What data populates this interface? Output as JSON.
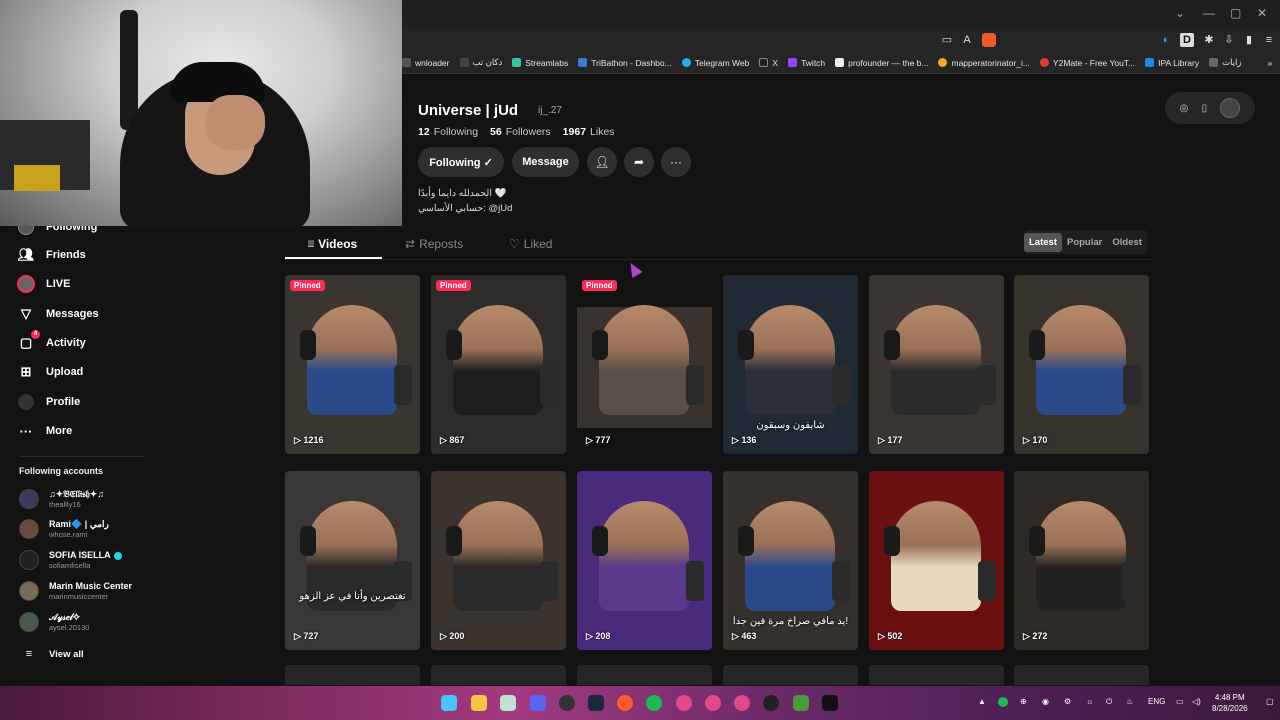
{
  "browser": {
    "bookmarks": [
      {
        "label": "wnloader",
        "color": "#555"
      },
      {
        "label": "دكان تب",
        "color": "#444"
      },
      {
        "label": "Streamlabs",
        "color": "#31c3a2"
      },
      {
        "label": "TriBathon - Dashbo...",
        "color": "#3a7bd5"
      },
      {
        "label": "Telegram Web",
        "color": "#2aabee"
      },
      {
        "label": "X",
        "color": "#222"
      },
      {
        "label": "Twitch",
        "color": "#9146ff"
      },
      {
        "label": "profounder — the b...",
        "color": "#eee"
      },
      {
        "label": "mapperatorinator_i...",
        "color": "#f5a623"
      },
      {
        "label": "Y2Mate - Free YouT...",
        "color": "#e53935"
      },
      {
        "label": "IPA Library",
        "color": "#1e88e5"
      },
      {
        "label": "زايات",
        "color": "#666"
      }
    ],
    "more_bookmarks": "»"
  },
  "sidebar": {
    "nav": [
      {
        "label": "Following",
        "icon": "following-avatar-icon"
      },
      {
        "label": "Friends",
        "icon": "friends-icon"
      },
      {
        "label": "LIVE",
        "icon": "live-icon"
      },
      {
        "label": "Messages",
        "icon": "messages-icon"
      },
      {
        "label": "Activity",
        "icon": "activity-icon",
        "badge": "4"
      },
      {
        "label": "Upload",
        "icon": "upload-icon"
      },
      {
        "label": "Profile",
        "icon": "profile-icon"
      },
      {
        "label": "More",
        "icon": "more-icon"
      }
    ],
    "following_title": "Following accounts",
    "accounts": [
      {
        "name": "♫✦𝔅𝔈𝔩𝔩𝔦𝔰𝔥✦♫",
        "user": "theallly16",
        "verified": false,
        "color": "#3a3a5a"
      },
      {
        "name": "Rami🔷 | رامي",
        "user": "whose.rami",
        "verified": false,
        "color": "#6a4a3a"
      },
      {
        "name": "SOFIA ISELLA",
        "user": "sofiamfisella",
        "verified": true,
        "color": "#222"
      },
      {
        "name": "Marin Music Center",
        "user": "marinmusiccenter",
        "verified": false,
        "color": "#7a6a5a"
      },
      {
        "name": "𝒜𝓎𝓈𝑒𝓁✧",
        "user": "aysel.20130",
        "verified": false,
        "color": "#4a5a4a"
      }
    ],
    "view_all": "View all"
  },
  "profile": {
    "name": "Universe | jUd",
    "username": "ij_.27",
    "following_count": "12",
    "following_label": "Following",
    "followers_count": "56",
    "followers_label": "Followers",
    "likes_count": "1967",
    "likes_label": "Likes",
    "following_button": "Following ✓",
    "message_button": "Message",
    "bio_line1": "الحمدلله دايما وأبدًا 🤍",
    "bio_line2": "حسابي الأساسي: @jUd"
  },
  "tabs": {
    "videos": "Videos",
    "reposts": "Reposts",
    "liked": "Liked"
  },
  "sort": {
    "latest": "Latest",
    "popular": "Popular",
    "oldest": "Oldest"
  },
  "videos": [
    {
      "views": "1216",
      "pinned": "Pinned",
      "bg": "#3b3530",
      "shirt": "#2a4a8a",
      "caption": ""
    },
    {
      "views": "867",
      "pinned": "Pinned",
      "bg": "#2e2c2a",
      "shirt": "#1e1e1e",
      "caption": ""
    },
    {
      "views": "777",
      "pinned": "Pinned",
      "bg": "#121212",
      "shirt": "#5a5048",
      "caption": ""
    },
    {
      "views": "136",
      "pinned": "",
      "bg": "#1f2a35",
      "shirt": "#2a2f3a",
      "caption": "شايفون وسبقون"
    },
    {
      "views": "177",
      "pinned": "",
      "bg": "#3a3530",
      "shirt": "#2a2a2a",
      "caption": ""
    },
    {
      "views": "170",
      "pinned": "",
      "bg": "#38322d",
      "shirt": "#2a4a8a",
      "caption": ""
    },
    {
      "views": "727",
      "pinned": "",
      "bg": "#3a3836",
      "shirt": "#2a2a2a",
      "caption": "تغتصرين وأنا في عز الزهو"
    },
    {
      "views": "200",
      "pinned": "",
      "bg": "#3a332e",
      "shirt": "#2a2a2a",
      "caption": ""
    },
    {
      "views": "208",
      "pinned": "",
      "bg": "#4a2a7a",
      "shirt": "#5a3a8a",
      "caption": ""
    },
    {
      "views": "463",
      "pinned": "",
      "bg": "#35302b",
      "shirt": "#2a4a8a",
      "caption": "يد مافي صراخ مرة فين جدا!"
    },
    {
      "views": "502",
      "pinned": "",
      "bg": "#6a1010",
      "shirt": "#e8d8c0",
      "caption": ""
    },
    {
      "views": "272",
      "pinned": "",
      "bg": "#2e2a26",
      "shirt": "#222",
      "caption": ""
    }
  ],
  "taskbar": {
    "lang": "ENG",
    "time": "4:48 PM",
    "date": "8/28/2026"
  }
}
